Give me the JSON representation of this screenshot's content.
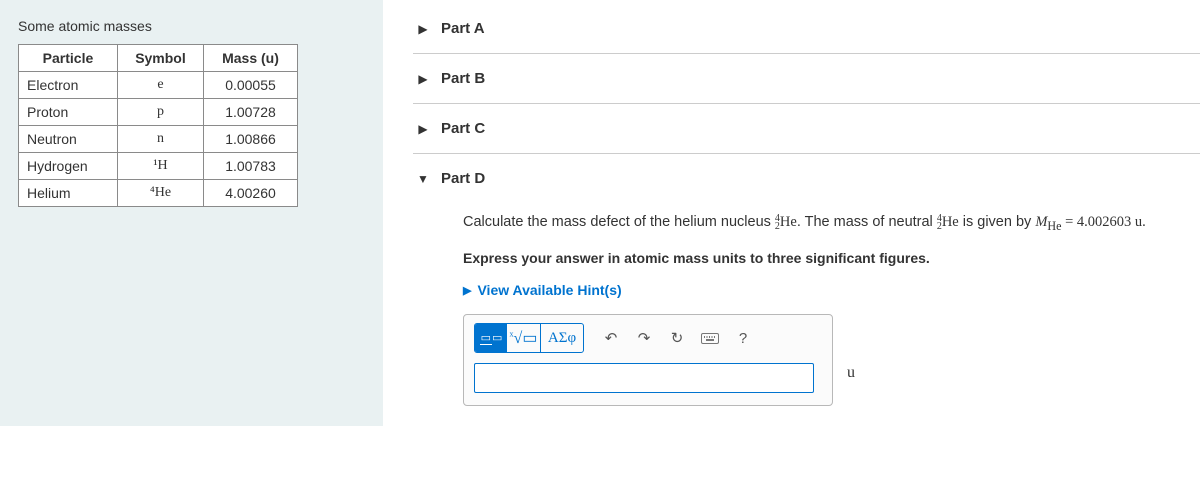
{
  "left": {
    "title": "Some atomic masses",
    "headers": [
      "Particle",
      "Symbol",
      "Mass (u)"
    ],
    "rows": [
      {
        "name": "Electron",
        "symbol": "e",
        "mass": "0.00055"
      },
      {
        "name": "Proton",
        "symbol": "p",
        "mass": "1.00728"
      },
      {
        "name": "Neutron",
        "symbol": "n",
        "mass": "1.00866"
      },
      {
        "name": "Hydrogen",
        "symbol": "¹H",
        "mass": "1.00783"
      },
      {
        "name": "Helium",
        "symbol": "⁴He",
        "mass": "4.00260"
      }
    ]
  },
  "parts": {
    "a": "Part A",
    "b": "Part B",
    "c": "Part C",
    "d": "Part D"
  },
  "partD": {
    "q1a": "Calculate the mass defect of the helium nucleus ",
    "nuc1_pre": "4",
    "nuc1_sub": "2",
    "nuc1_el": "He",
    "q1b": ". The mass of neutral ",
    "nuc2_pre": "4",
    "nuc2_sub": "2",
    "nuc2_el": "He",
    "q1c": " is given by ",
    "mvar": "M",
    "msub": "He",
    "eq": " = 4.002603 u.",
    "instr": "Express your answer in atomic mass units to three significant figures.",
    "hints": "View Available Hint(s)",
    "toolbar": {
      "templates": "▭",
      "sqrt": "ᵡ√▭",
      "greek": "ΑΣφ",
      "undo": "↶",
      "redo": "↷",
      "reset": "↻",
      "keyboard": "keyboard",
      "help": "?"
    },
    "unit": "u"
  }
}
